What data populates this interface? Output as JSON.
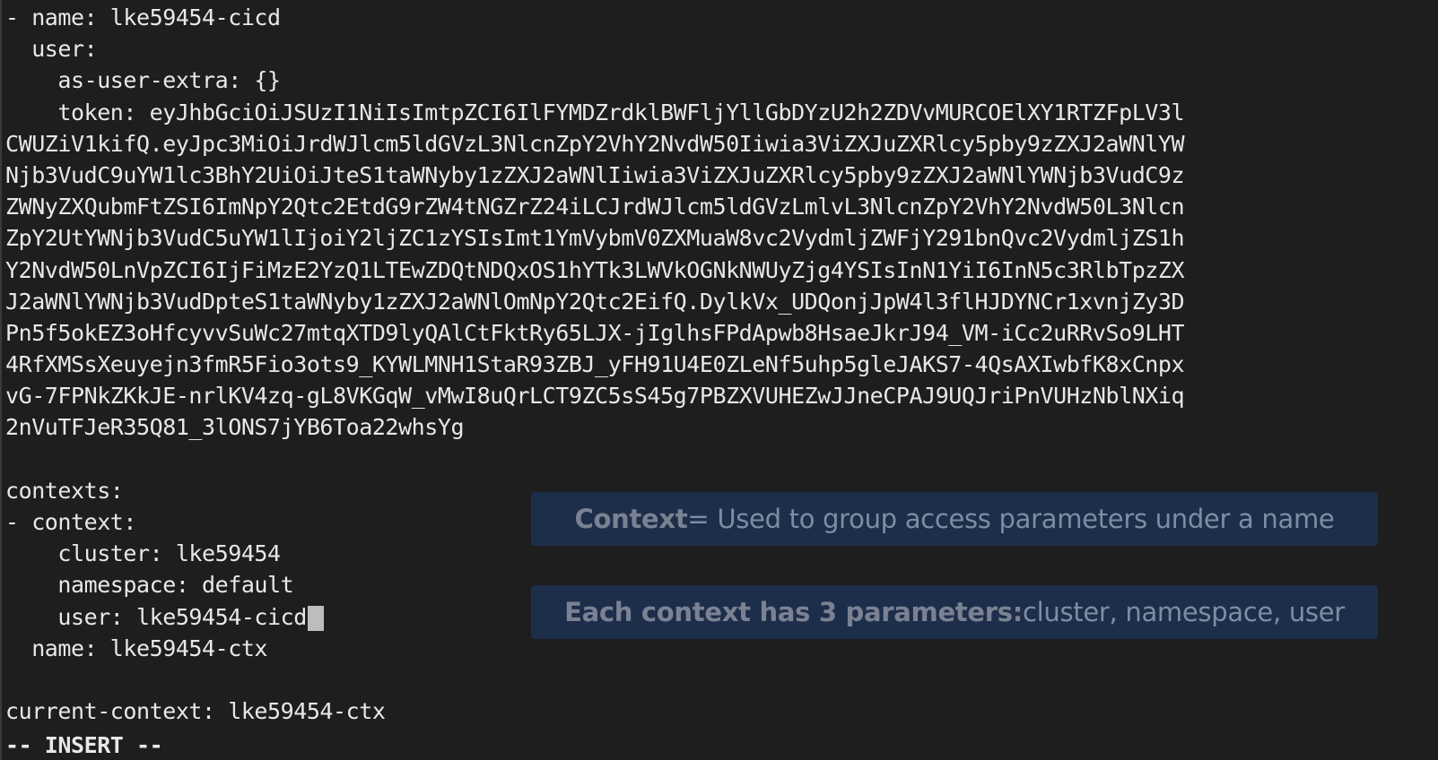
{
  "editor": {
    "lines": [
      "- name: lke59454-cicd",
      "  user:",
      "    as-user-extra: {}",
      "    token: eyJhbGciOiJSUzI1NiIsImtpZCI6IlFYMDZrdklBWFljYllGbDYzU2h2ZDVvMURCOElXY1RTZFpLV3l",
      "CWUZiV1kifQ.eyJpc3MiOiJrdWJlcm5ldGVzL3NlcnZpY2VhY2NvdW50Iiwia3ViZXJuZXRlcy5pby9zZXJ2aWNlYW",
      "Njb3VudC9uYW1lc3BhY2UiOiJteS1taWNyby1zZXJ2aWNlIiwia3ViZXJuZXRlcy5pby9zZXJ2aWNlYWNjb3VudC9z",
      "ZWNyZXQubmFtZSI6ImNpY2Qtc2EtdG9rZW4tNGZrZ24iLCJrdWJlcm5ldGVzLmlvL3NlcnZpY2VhY2NvdW50L3Nlcn",
      "ZpY2UtYWNjb3VudC5uYW1lIjoiY2ljZC1zYSIsImt1YmVybmV0ZXMuaW8vc2VydmljZWFjY291bnQvc2VydmljZS1h",
      "Y2NvdW50LnVpZCI6IjFiMzE2YzQ1LTEwZDQtNDQxOS1hYTk3LWVkOGNkNWUyZjg4YSIsInN1YiI6InN5c3RlbTpzZX",
      "J2aWNlYWNjb3VudDpteS1taWNyby1zZXJ2aWNlOmNpY2Qtc2EifQ.DylkVx_UDQonjJpW4l3flHJDYNCr1xvnjZy3D",
      "Pn5f5okEZ3oHfcyvvSuWc27mtqXTD9lyQAlCtFktRy65LJX-jIglhsFPdApwb8HsaeJkrJ94_VM-iCc2uRRvSo9LHT",
      "4RfXMSsXeuyejn3fmR5Fio3ots9_KYWLMNH1StaR93ZBJ_yFH91U4E0ZLeNf5uhp5gleJAKS7-4QsAXIwbfK8xCnpx",
      "vG-7FPNkZKkJE-nrlKV4zq-gL8VKGqW_vMwI8uQrLCT9ZC5sS45g7PBZXVUHEZwJJneCPAJ9UQJriPnVUHzNblNXiq",
      "2nVuTFJeR35Q81_3lONS7jYB6Toa22whsYg",
      "",
      "contexts:",
      "- context:",
      "    cluster: lke59454",
      "    namespace: default",
      "    user: lke59454-cicd",
      "  name: lke59454-ctx",
      "",
      "current-context: lke59454-ctx"
    ],
    "status": "-- INSERT --"
  },
  "overlays": {
    "context_def": {
      "term": "Context",
      "definition": " = Used to group access parameters under a name"
    },
    "context_params": {
      "lead": "Each context has 3 parameters:",
      "params": " cluster, namespace, user"
    }
  }
}
